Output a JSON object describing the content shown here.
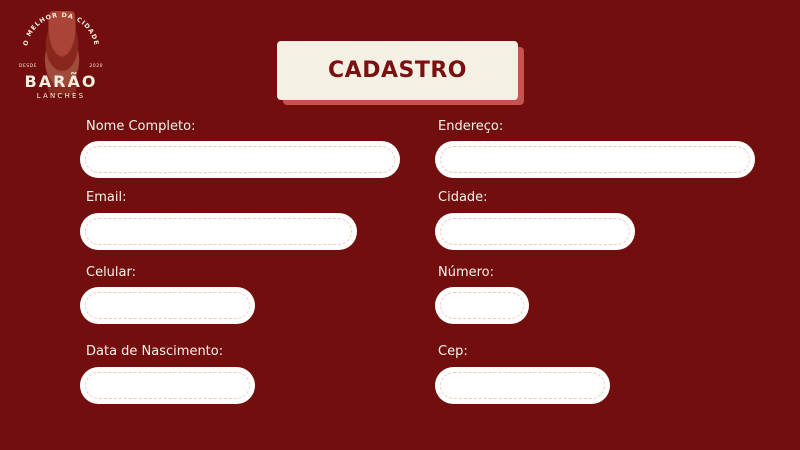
{
  "logo": {
    "arc_text": "O MELHOR DA CIDADE",
    "desde": "DESDE",
    "year": "2020",
    "name": "BARÃO",
    "subtitle": "LANCHES",
    "icon": "burger-icon"
  },
  "header": {
    "title": "CADASTRO"
  },
  "form": {
    "nome_completo": {
      "label": "Nome Completo:",
      "value": ""
    },
    "endereco": {
      "label": "Endereço:",
      "value": ""
    },
    "email": {
      "label": "Email:",
      "value": ""
    },
    "cidade": {
      "label": "Cidade:",
      "value": ""
    },
    "celular": {
      "label": "Celular:",
      "value": ""
    },
    "numero": {
      "label": "Número:",
      "value": ""
    },
    "data_nascimento": {
      "label": "Data de Nascimento:",
      "value": ""
    },
    "cep": {
      "label": "Cep:",
      "value": ""
    }
  },
  "colors": {
    "background": "#730e0e",
    "title_box": "#f5f0e4",
    "title_shadow": "#c8524f",
    "title_text": "#7a1010",
    "label_text": "#f8f2ea",
    "input_bg": "#ffffff",
    "input_dash": "#f0c9bd"
  }
}
